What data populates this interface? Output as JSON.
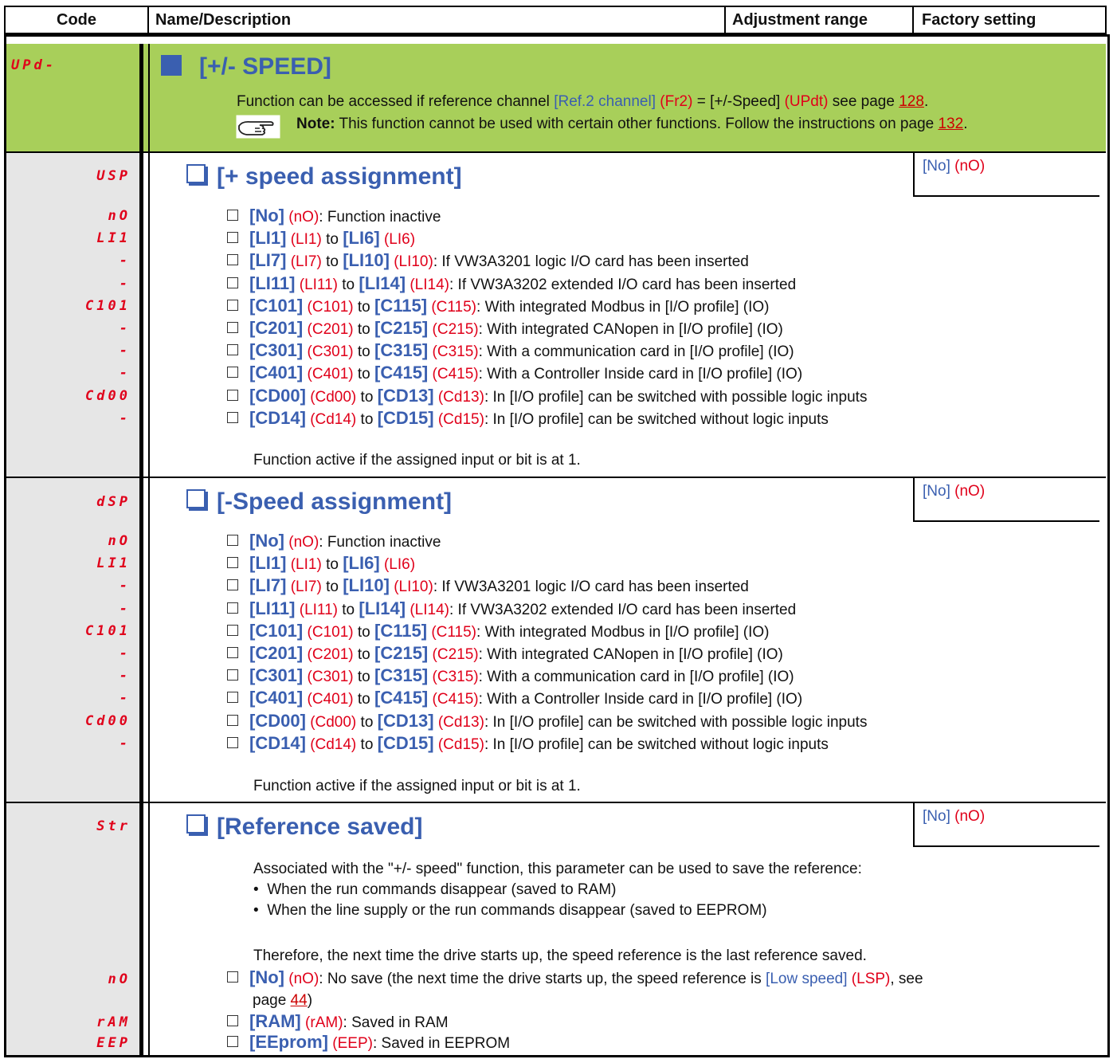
{
  "header": {
    "code": "Code",
    "name": "Name/Description",
    "range": "Adjustment range",
    "factory": "Factory setting"
  },
  "menu": {
    "code": "UPd-",
    "title": "[+/- SPEED]",
    "line1_pre": "Function can be accessed if reference channel ",
    "line1_ref": "[Ref.2 channel]",
    "line1_code": "(Fr2)",
    "line1_eq": " = [+/-Speed] ",
    "line1_code2": "(UPdt)",
    "line1_post": " see page ",
    "line1_page": "128",
    "note_label": "Note:",
    "note_text": " This function cannot be used with certain other functions. Follow the instructions on page ",
    "note_page": "132"
  },
  "usp": {
    "code": "USP",
    "title": "[+ speed assignment]",
    "factory_name": "[No]",
    "factory_code": "(nO)",
    "codes": [
      "nO",
      "LI1",
      "-",
      "-",
      "C101",
      "-",
      "-",
      "-",
      "Cd00",
      "-"
    ],
    "footer": "Function active if the assigned input or bit is at 1."
  },
  "dsp": {
    "code": "dSP",
    "title": "[-Speed assignment]",
    "factory_name": "[No]",
    "factory_code": "(nO)",
    "codes": [
      "nO",
      "LI1",
      "-",
      "-",
      "C101",
      "-",
      "-",
      "-",
      "Cd00",
      "-"
    ],
    "footer": "Function active if the assigned input or bit is at 1."
  },
  "options": [
    {
      "a": "[No]",
      "ac": "(nO)",
      "b": "",
      "bc": "",
      "desc": ": Function inactive"
    },
    {
      "a": "[LI1]",
      "ac": "(LI1)",
      "b": "[LI6]",
      "bc": "(LI6)",
      "desc": ""
    },
    {
      "a": "[LI7]",
      "ac": "(LI7)",
      "b": "[LI10]",
      "bc": "(LI10)",
      "desc": ": If VW3A3201 logic I/O card has been inserted"
    },
    {
      "a": "[LI11]",
      "ac": "(LI11)",
      "b": "[LI14]",
      "bc": "(LI14)",
      "desc": ": If VW3A3202 extended I/O card has been inserted"
    },
    {
      "a": "[C101]",
      "ac": "(C101)",
      "b": "[C115]",
      "bc": "(C115)",
      "desc": ": With integrated Modbus in [I/O profile] (IO)"
    },
    {
      "a": "[C201]",
      "ac": "(C201)",
      "b": "[C215]",
      "bc": "(C215)",
      "desc": ": With integrated CANopen in [I/O profile] (IO)"
    },
    {
      "a": "[C301]",
      "ac": "(C301)",
      "b": "[C315]",
      "bc": "(C315)",
      "desc": ": With a communication card in [I/O profile] (IO)"
    },
    {
      "a": "[C401]",
      "ac": "(C401)",
      "b": "[C415]",
      "bc": "(C415)",
      "desc": ": With a Controller Inside card in [I/O profile] (IO)"
    },
    {
      "a": "[CD00]",
      "ac": "(Cd00)",
      "b": "[CD13]",
      "bc": "(Cd13)",
      "desc": ": In [I/O profile] can be switched with possible logic inputs"
    },
    {
      "a": "[CD14]",
      "ac": "(Cd14)",
      "b": "[CD15]",
      "bc": "(Cd15)",
      "desc": ": In [I/O profile] can be switched without logic inputs"
    }
  ],
  "to_word": " to ",
  "str": {
    "code": "Str",
    "title": "[Reference saved]",
    "factory_name": "[No]",
    "factory_code": "(nO)",
    "intro": "Associated with the \"+/- speed\" function, this parameter can be used to save the reference:",
    "bullet1": "When the run commands disappear (saved to RAM)",
    "bullet2": "When the line supply or the run commands disappear (saved to EEPROM)",
    "therefore": "Therefore, the next time the drive starts up, the speed reference is the last reference saved.",
    "codes": [
      "nO",
      "rAM",
      "EEP"
    ],
    "opt_no_name": "[No]",
    "opt_no_code": "(nO)",
    "opt_no_desc1": ": No save (the next time the drive starts up, the speed reference is ",
    "opt_no_ref": "[Low speed]",
    "opt_no_refcode": "(LSP)",
    "opt_no_desc2": ", see",
    "opt_no_page_pre": "page ",
    "opt_no_page": "44",
    "opt_no_page_post": ")",
    "opt_ram_name": "[RAM]",
    "opt_ram_code": "(rAM)",
    "opt_ram_desc": ": Saved in RAM",
    "opt_eep_name": "[EEprom]",
    "opt_eep_code": "(EEP)",
    "opt_eep_desc": ": Saved in EEPROM"
  }
}
